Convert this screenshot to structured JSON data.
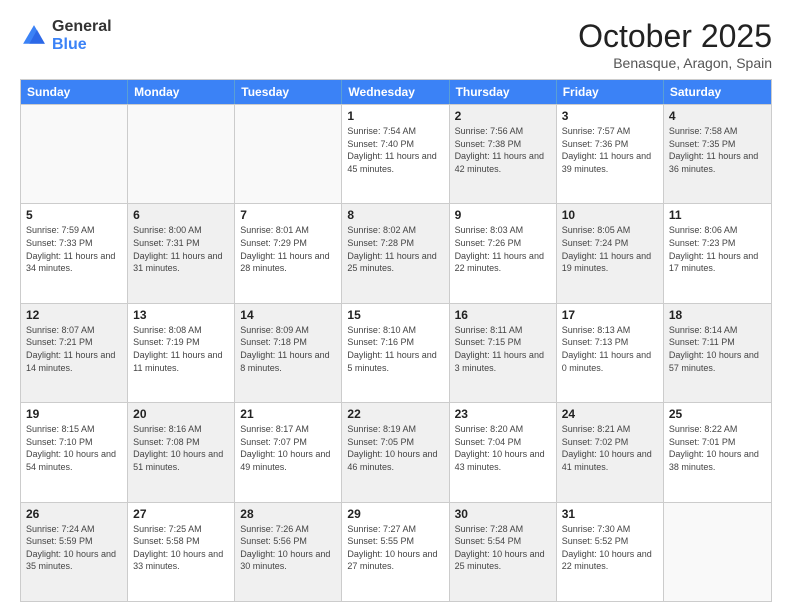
{
  "logo": {
    "general": "General",
    "blue": "Blue"
  },
  "header": {
    "month": "October 2025",
    "location": "Benasque, Aragon, Spain"
  },
  "weekdays": [
    "Sunday",
    "Monday",
    "Tuesday",
    "Wednesday",
    "Thursday",
    "Friday",
    "Saturday"
  ],
  "rows": [
    [
      {
        "day": "",
        "info": "",
        "empty": true
      },
      {
        "day": "",
        "info": "",
        "empty": true
      },
      {
        "day": "",
        "info": "",
        "empty": true
      },
      {
        "day": "1",
        "info": "Sunrise: 7:54 AM\nSunset: 7:40 PM\nDaylight: 11 hours and 45 minutes.",
        "shaded": false
      },
      {
        "day": "2",
        "info": "Sunrise: 7:56 AM\nSunset: 7:38 PM\nDaylight: 11 hours and 42 minutes.",
        "shaded": true
      },
      {
        "day": "3",
        "info": "Sunrise: 7:57 AM\nSunset: 7:36 PM\nDaylight: 11 hours and 39 minutes.",
        "shaded": false
      },
      {
        "day": "4",
        "info": "Sunrise: 7:58 AM\nSunset: 7:35 PM\nDaylight: 11 hours and 36 minutes.",
        "shaded": true
      }
    ],
    [
      {
        "day": "5",
        "info": "Sunrise: 7:59 AM\nSunset: 7:33 PM\nDaylight: 11 hours and 34 minutes.",
        "shaded": false
      },
      {
        "day": "6",
        "info": "Sunrise: 8:00 AM\nSunset: 7:31 PM\nDaylight: 11 hours and 31 minutes.",
        "shaded": true
      },
      {
        "day": "7",
        "info": "Sunrise: 8:01 AM\nSunset: 7:29 PM\nDaylight: 11 hours and 28 minutes.",
        "shaded": false
      },
      {
        "day": "8",
        "info": "Sunrise: 8:02 AM\nSunset: 7:28 PM\nDaylight: 11 hours and 25 minutes.",
        "shaded": true
      },
      {
        "day": "9",
        "info": "Sunrise: 8:03 AM\nSunset: 7:26 PM\nDaylight: 11 hours and 22 minutes.",
        "shaded": false
      },
      {
        "day": "10",
        "info": "Sunrise: 8:05 AM\nSunset: 7:24 PM\nDaylight: 11 hours and 19 minutes.",
        "shaded": true
      },
      {
        "day": "11",
        "info": "Sunrise: 8:06 AM\nSunset: 7:23 PM\nDaylight: 11 hours and 17 minutes.",
        "shaded": false
      }
    ],
    [
      {
        "day": "12",
        "info": "Sunrise: 8:07 AM\nSunset: 7:21 PM\nDaylight: 11 hours and 14 minutes.",
        "shaded": true
      },
      {
        "day": "13",
        "info": "Sunrise: 8:08 AM\nSunset: 7:19 PM\nDaylight: 11 hours and 11 minutes.",
        "shaded": false
      },
      {
        "day": "14",
        "info": "Sunrise: 8:09 AM\nSunset: 7:18 PM\nDaylight: 11 hours and 8 minutes.",
        "shaded": true
      },
      {
        "day": "15",
        "info": "Sunrise: 8:10 AM\nSunset: 7:16 PM\nDaylight: 11 hours and 5 minutes.",
        "shaded": false
      },
      {
        "day": "16",
        "info": "Sunrise: 8:11 AM\nSunset: 7:15 PM\nDaylight: 11 hours and 3 minutes.",
        "shaded": true
      },
      {
        "day": "17",
        "info": "Sunrise: 8:13 AM\nSunset: 7:13 PM\nDaylight: 11 hours and 0 minutes.",
        "shaded": false
      },
      {
        "day": "18",
        "info": "Sunrise: 8:14 AM\nSunset: 7:11 PM\nDaylight: 10 hours and 57 minutes.",
        "shaded": true
      }
    ],
    [
      {
        "day": "19",
        "info": "Sunrise: 8:15 AM\nSunset: 7:10 PM\nDaylight: 10 hours and 54 minutes.",
        "shaded": false
      },
      {
        "day": "20",
        "info": "Sunrise: 8:16 AM\nSunset: 7:08 PM\nDaylight: 10 hours and 51 minutes.",
        "shaded": true
      },
      {
        "day": "21",
        "info": "Sunrise: 8:17 AM\nSunset: 7:07 PM\nDaylight: 10 hours and 49 minutes.",
        "shaded": false
      },
      {
        "day": "22",
        "info": "Sunrise: 8:19 AM\nSunset: 7:05 PM\nDaylight: 10 hours and 46 minutes.",
        "shaded": true
      },
      {
        "day": "23",
        "info": "Sunrise: 8:20 AM\nSunset: 7:04 PM\nDaylight: 10 hours and 43 minutes.",
        "shaded": false
      },
      {
        "day": "24",
        "info": "Sunrise: 8:21 AM\nSunset: 7:02 PM\nDaylight: 10 hours and 41 minutes.",
        "shaded": true
      },
      {
        "day": "25",
        "info": "Sunrise: 8:22 AM\nSunset: 7:01 PM\nDaylight: 10 hours and 38 minutes.",
        "shaded": false
      }
    ],
    [
      {
        "day": "26",
        "info": "Sunrise: 7:24 AM\nSunset: 5:59 PM\nDaylight: 10 hours and 35 minutes.",
        "shaded": true
      },
      {
        "day": "27",
        "info": "Sunrise: 7:25 AM\nSunset: 5:58 PM\nDaylight: 10 hours and 33 minutes.",
        "shaded": false
      },
      {
        "day": "28",
        "info": "Sunrise: 7:26 AM\nSunset: 5:56 PM\nDaylight: 10 hours and 30 minutes.",
        "shaded": true
      },
      {
        "day": "29",
        "info": "Sunrise: 7:27 AM\nSunset: 5:55 PM\nDaylight: 10 hours and 27 minutes.",
        "shaded": false
      },
      {
        "day": "30",
        "info": "Sunrise: 7:28 AM\nSunset: 5:54 PM\nDaylight: 10 hours and 25 minutes.",
        "shaded": true
      },
      {
        "day": "31",
        "info": "Sunrise: 7:30 AM\nSunset: 5:52 PM\nDaylight: 10 hours and 22 minutes.",
        "shaded": false
      },
      {
        "day": "",
        "info": "",
        "empty": true
      }
    ]
  ]
}
